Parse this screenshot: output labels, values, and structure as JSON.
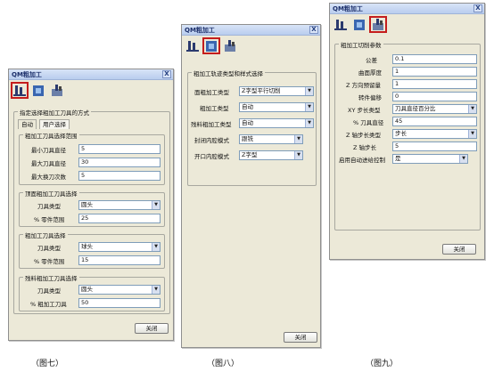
{
  "windows": [
    {
      "title": "QM粗加工",
      "close": "X",
      "group_title": "指定选择粗加工刀具的方式",
      "tabs": [
        "自动",
        "用户选择"
      ],
      "sections": [
        {
          "title": "粗加工刀具选择范围",
          "rows": [
            {
              "label": "最小刀具直径",
              "value": "5"
            },
            {
              "label": "最大刀具直径",
              "value": "30"
            },
            {
              "label": "最大换刀次数",
              "value": "5"
            }
          ]
        },
        {
          "title": "顶面粗加工刀具选择",
          "rows": [
            {
              "label": "刀具类型",
              "value": "圆头"
            },
            {
              "label": "% 零件范围",
              "value": "25"
            }
          ]
        },
        {
          "title": "粗加工刀具选择",
          "rows": [
            {
              "label": "刀具类型",
              "value": "球头"
            },
            {
              "label": "% 零件范围",
              "value": "15"
            }
          ]
        },
        {
          "title": "残料粗加工刀具选择",
          "rows": [
            {
              "label": "刀具类型",
              "value": "圆头"
            },
            {
              "label": "% 粗加工刀具",
              "value": "50"
            }
          ]
        }
      ],
      "button": "关闭"
    },
    {
      "title": "QM粗加工",
      "close": "X",
      "group_title": "粗加工轨迹类型和样式选择",
      "rows": [
        {
          "label": "面粗加工类型",
          "value": "Z字型平行切削"
        },
        {
          "label": "粗加工类型",
          "value": "自动"
        },
        {
          "label": "残料粗加工类型",
          "value": "自动"
        },
        {
          "label": "封闭内腔模式",
          "value": "跟铣"
        },
        {
          "label": "开口内腔模式",
          "value": "Z字型"
        }
      ],
      "button": "关闭"
    },
    {
      "title": "QM粗加工",
      "close": "X",
      "group_title": "粗加工切削参数",
      "rows": [
        {
          "label": "公差",
          "value": "0.1"
        },
        {
          "label": "曲面厚度",
          "value": "1"
        },
        {
          "label": "Z 方向预留量",
          "value": "1"
        },
        {
          "label": "转件偏移",
          "value": "0"
        },
        {
          "label": "XY 步长类型",
          "value": "刀具直径百分比"
        },
        {
          "label": "% 刀具直径",
          "value": "45"
        },
        {
          "label": "Z 轴步长类型",
          "value": "步长"
        },
        {
          "label": "Z 轴步长",
          "value": "5"
        },
        {
          "label": "启用自动进给控制",
          "value": "是"
        }
      ],
      "button": "关闭"
    }
  ],
  "captions": [
    "（图七）",
    "（图八）",
    "（图九）"
  ],
  "colors": {
    "dialog_bg": "#ece9d8",
    "highlight": "#c41d1d"
  }
}
